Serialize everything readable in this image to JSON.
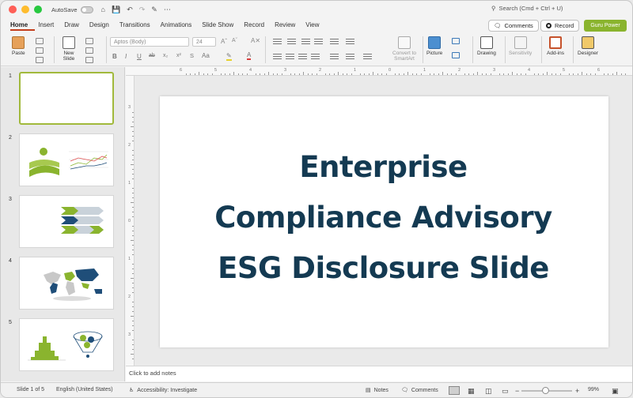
{
  "titlebar": {
    "autosave_label": "AutoSave",
    "search_placeholder": "Search (Cmd + Ctrl + U)"
  },
  "tabs": [
    "Home",
    "Insert",
    "Draw",
    "Design",
    "Transitions",
    "Animations",
    "Slide Show",
    "Record",
    "Review",
    "View"
  ],
  "header_buttons": {
    "comments": "Comments",
    "record": "Record",
    "guru": "Guru Power"
  },
  "ribbon": {
    "paste": "Paste",
    "new_slide_1": "New",
    "new_slide_2": "Slide",
    "font_name": "Aptos (Body)",
    "font_size": "24",
    "convert_smartart_1": "Convert to",
    "convert_smartart_2": "SmartArt",
    "picture": "Picture",
    "drawing": "Drawing",
    "sensitivity": "Sensitivity",
    "addins": "Add-ins",
    "designer": "Designer",
    "format_bold": "B",
    "format_italic": "I",
    "format_underline": "U",
    "format_strike": "ab",
    "format_sub": "x₂",
    "format_sup": "x²",
    "format_aa": "Aa",
    "format_a": "A"
  },
  "slides": [
    {
      "number": "1"
    },
    {
      "number": "2"
    },
    {
      "number": "3"
    },
    {
      "number": "4"
    },
    {
      "number": "5"
    }
  ],
  "ruler_h": [
    "6",
    "5",
    "4",
    "3",
    "2",
    "1",
    "0",
    "1",
    "2",
    "3",
    "4",
    "5",
    "6"
  ],
  "ruler_v": [
    "3",
    "2",
    "1",
    "0",
    "1",
    "2",
    "3"
  ],
  "slide": {
    "title_line1": "Enterprise",
    "title_line2": "Compliance Advisory",
    "title_line3": "ESG Disclosure Slide"
  },
  "notes_placeholder": "Click to add notes",
  "status": {
    "slide_of": "Slide 1 of 5",
    "language": "English (United States)",
    "accessibility": "Accessibility: Investigate",
    "notes": "Notes",
    "comments": "Comments",
    "zoom": "99%"
  },
  "colors": {
    "title": "#143a52",
    "accent_green": "#8ab42e",
    "tab_underline": "#c43e1c",
    "selected_border": "#a1b93b",
    "chart_blue": "#1f4e79"
  }
}
